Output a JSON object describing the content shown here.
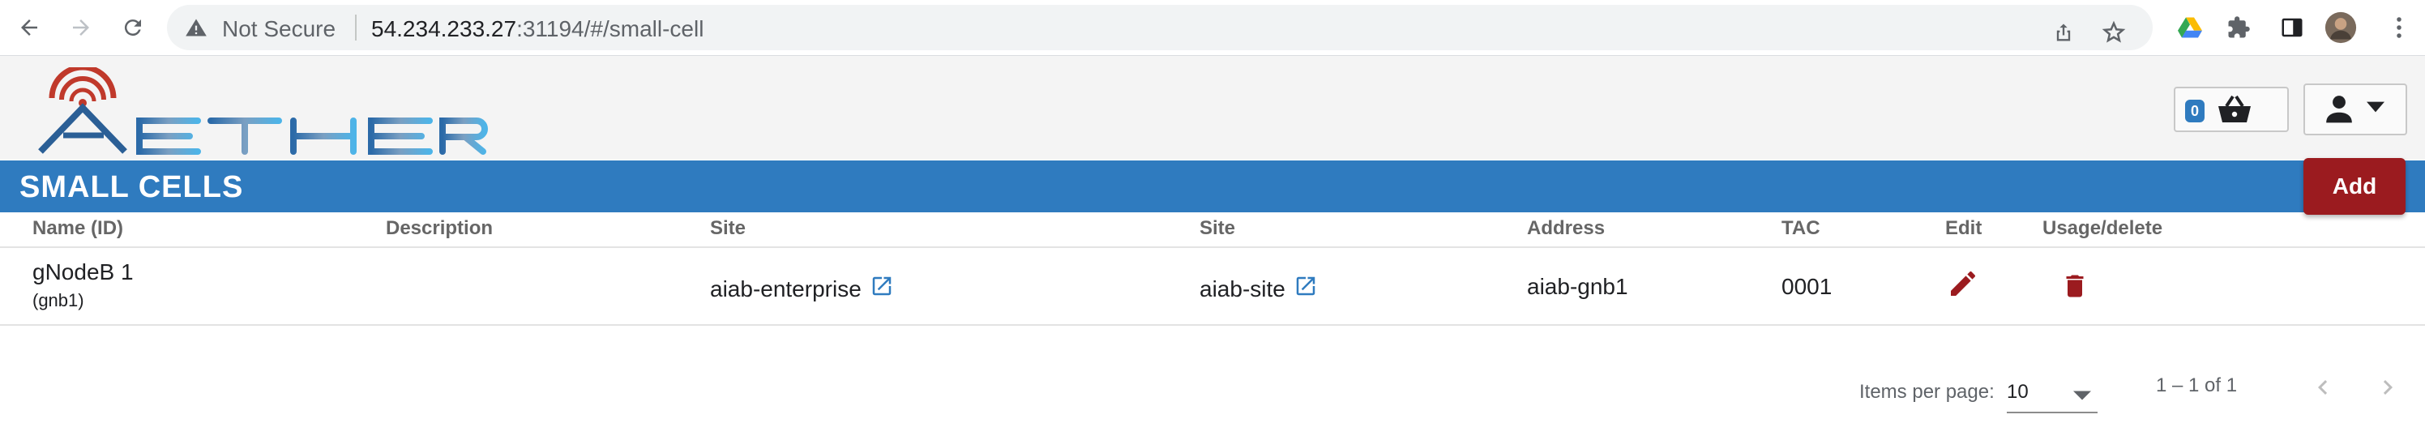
{
  "browser": {
    "security_label": "Not Secure",
    "url_host": "54.234.233.27",
    "url_rest": ":31194/#/small-cell"
  },
  "header": {
    "logo_text": "AETHER",
    "cart_count": "0"
  },
  "page": {
    "title": "SMALL CELLS",
    "add_label": "Add"
  },
  "table": {
    "columns": [
      "Name (ID)",
      "Description",
      "Site",
      "Site",
      "Address",
      "TAC",
      "Edit",
      "Usage/delete"
    ],
    "rows": [
      {
        "name": "gNodeB 1",
        "id": "(gnb1)",
        "description": "",
        "enterprise": "aiab-enterprise",
        "site": "aiab-site",
        "address": "aiab-gnb1",
        "tac": "0001"
      }
    ]
  },
  "paginator": {
    "items_per_page_label": "Items per page:",
    "page_size": "10",
    "range_label": "1 – 1 of 1"
  },
  "colors": {
    "brand_blue": "#2f7bbf",
    "action_red": "#9b1b1f"
  }
}
